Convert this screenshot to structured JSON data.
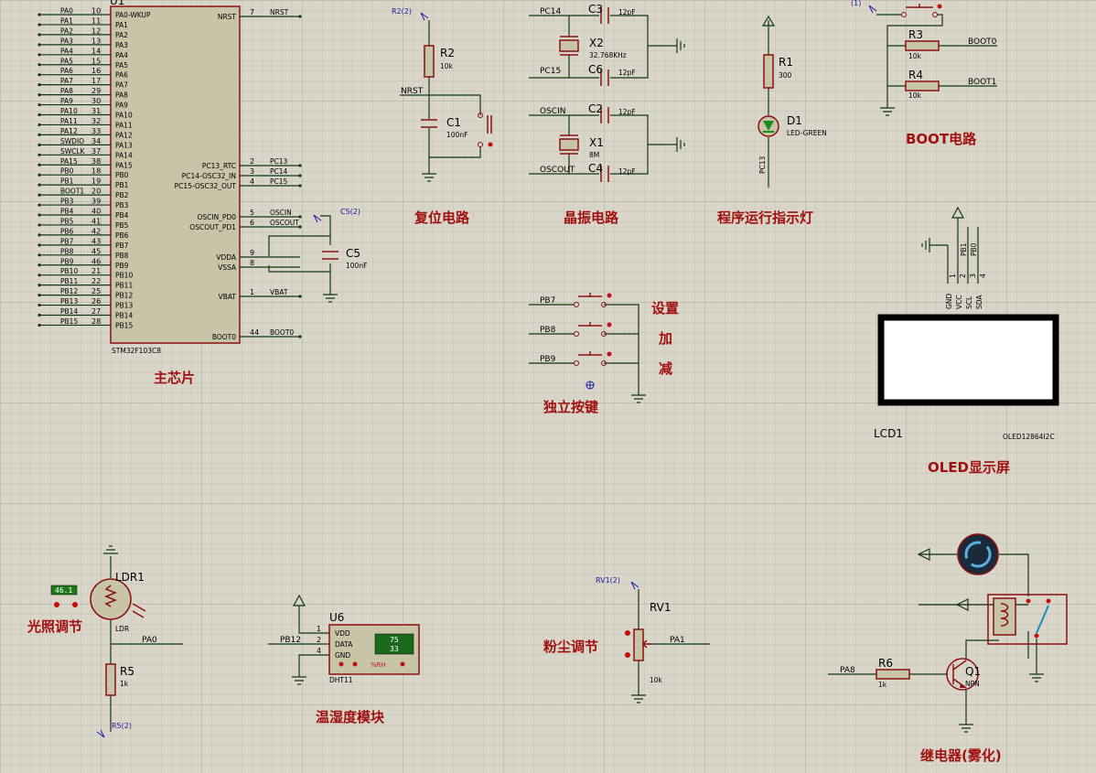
{
  "chip": {
    "ref": "U1",
    "part": "STM32F103C8",
    "title": "主芯片",
    "left_pins": [
      {
        "net": "PA0",
        "num": "10",
        "name": "PA0-WKUP"
      },
      {
        "net": "PA1",
        "num": "11",
        "name": "PA1"
      },
      {
        "net": "PA2",
        "num": "12",
        "name": "PA2"
      },
      {
        "net": "PA3",
        "num": "13",
        "name": "PA3"
      },
      {
        "net": "PA4",
        "num": "14",
        "name": "PA4"
      },
      {
        "net": "PA5",
        "num": "15",
        "name": "PA5"
      },
      {
        "net": "PA6",
        "num": "16",
        "name": "PA6"
      },
      {
        "net": "PA7",
        "num": "17",
        "name": "PA7"
      },
      {
        "net": "PA8",
        "num": "29",
        "name": "PA8"
      },
      {
        "net": "PA9",
        "num": "30",
        "name": "PA9"
      },
      {
        "net": "PA10",
        "num": "31",
        "name": "PA10"
      },
      {
        "net": "PA11",
        "num": "32",
        "name": "PA11"
      },
      {
        "net": "PA12",
        "num": "33",
        "name": "PA12"
      },
      {
        "net": "SWDIO",
        "num": "34",
        "name": "PA13"
      },
      {
        "net": "SWCLK",
        "num": "37",
        "name": "PA14"
      },
      {
        "net": "PA15",
        "num": "38",
        "name": "PA15"
      },
      {
        "net": "PB0",
        "num": "18",
        "name": "PB0"
      },
      {
        "net": "PB1",
        "num": "19",
        "name": "PB1"
      },
      {
        "net": "BOOT1",
        "num": "20",
        "name": "PB2"
      },
      {
        "net": "PB3",
        "num": "39",
        "name": "PB3"
      },
      {
        "net": "PB4",
        "num": "40",
        "name": "PB4"
      },
      {
        "net": "PB5",
        "num": "41",
        "name": "PB5"
      },
      {
        "net": "PB6",
        "num": "42",
        "name": "PB6"
      },
      {
        "net": "PB7",
        "num": "43",
        "name": "PB7"
      },
      {
        "net": "PB8",
        "num": "45",
        "name": "PB8"
      },
      {
        "net": "PB9",
        "num": "46",
        "name": "PB9"
      },
      {
        "net": "PB10",
        "num": "21",
        "name": "PB10"
      },
      {
        "net": "PB11",
        "num": "22",
        "name": "PB11"
      },
      {
        "net": "PB12",
        "num": "25",
        "name": "PB12"
      },
      {
        "net": "PB13",
        "num": "26",
        "name": "PB13"
      },
      {
        "net": "PB14",
        "num": "27",
        "name": "PB14"
      },
      {
        "net": "PB15",
        "num": "28",
        "name": "PB15"
      }
    ],
    "right_pins": [
      {
        "name": "NRST",
        "num": "7",
        "net": "NRST"
      },
      {
        "name": "PC13_RTC",
        "num": "2",
        "net": "PC13"
      },
      {
        "name": "PC14-OSC32_IN",
        "num": "3",
        "net": "PC14"
      },
      {
        "name": "PC15-OSC32_OUT",
        "num": "4",
        "net": "PC15"
      },
      {
        "name": "OSCIN_PD0",
        "num": "5",
        "net": "OSCIN"
      },
      {
        "name": "OSCOUT_PD1",
        "num": "6",
        "net": "OSCOUT"
      },
      {
        "name": "VDDA",
        "num": "9",
        "net": ""
      },
      {
        "name": "VSSA",
        "num": "8",
        "net": ""
      },
      {
        "name": "VBAT",
        "num": "1",
        "net": "VBAT"
      },
      {
        "name": "BOOT0",
        "num": "44",
        "net": "BOOT0"
      }
    ]
  },
  "c5": {
    "ref": "C5",
    "value": "100nF",
    "terminal": "C5(2)"
  },
  "reset": {
    "title": "复位电路",
    "r_ref": "R2",
    "r_val": "10k",
    "c_ref": "C1",
    "c_val": "100nF",
    "net": "NRST",
    "terminal": "R2(2)"
  },
  "crystal": {
    "title": "晶振电路",
    "c3": "C3",
    "c6": "C6",
    "c2": "C2",
    "c4": "C4",
    "cap_val": "12pF",
    "x2": "X2",
    "x2_freq": "32.768KHz",
    "x1": "X1",
    "x1_freq": "8M",
    "pc14": "PC14",
    "pc15": "PC15",
    "oscin": "OSCIN",
    "oscout": "OSCOUT"
  },
  "led": {
    "title": "程序运行指示灯",
    "r_ref": "R1",
    "r_val": "300",
    "d_ref": "D1",
    "d_val": "LED-GREEN",
    "net": "PC13"
  },
  "boot": {
    "title": "BOOT电路",
    "r3": "R3",
    "r4": "R4",
    "r_val": "10k",
    "boot0": "BOOT0",
    "boot1": "BOOT1",
    "terminal": "(1)"
  },
  "keys": {
    "title": "独立按键",
    "nets": [
      "PB7",
      "PB8",
      "PB9"
    ],
    "labels": [
      "设置",
      "加",
      "减"
    ]
  },
  "oled": {
    "title": "OLED显示屏",
    "ref": "LCD1",
    "part": "OLED12864I2C",
    "pins": [
      "GND",
      "VCC",
      "SCL",
      "SDA"
    ],
    "pin_nums": [
      "1",
      "2",
      "3",
      "4"
    ],
    "nets": [
      "PB1",
      "PB0"
    ]
  },
  "ldr": {
    "title": "光照调节",
    "ref": "LDR1",
    "type": "LDR",
    "reading": "46.1",
    "r_ref": "R5",
    "r_val": "1k",
    "net": "PA0",
    "terminal": "R5(2)"
  },
  "dht": {
    "title": "温湿度模块",
    "ref": "U6",
    "part": "DHT11",
    "pins": [
      "VDD",
      "DATA",
      "GND"
    ],
    "pin_nums": [
      "1",
      "2",
      "4"
    ],
    "net": "PB12",
    "temp": "75",
    "hum": "33",
    "unit": "%RH"
  },
  "dust": {
    "title": "粉尘调节",
    "ref": "RV1",
    "value": "10k",
    "net": "PA1",
    "terminal": "RV1(2)"
  },
  "relay": {
    "title": "继电器(雾化)",
    "q_ref": "Q1",
    "q_type": "NPN",
    "r_ref": "R6",
    "r_val": "1k",
    "net": "PA8"
  }
}
